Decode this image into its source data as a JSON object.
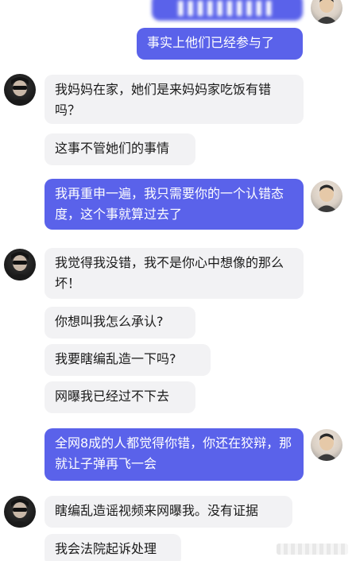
{
  "conversation": {
    "messages": [
      {
        "side": "right",
        "text": "▌▌▌▌▌▌▌▌▌▌",
        "obscured": true
      },
      {
        "side": "right",
        "text": "事实上他们已经参与了"
      },
      {
        "side": "left",
        "text": "我妈妈在家，她们是来妈妈家吃饭有错吗？"
      },
      {
        "side": "left",
        "text": "这事不管她们的事情"
      },
      {
        "side": "right",
        "text": "我再重申一遍，我只需要你的一个认错态度，这个事就算过去了"
      },
      {
        "side": "left",
        "text": "我觉得我没错，我不是你心中想像的那么坏！"
      },
      {
        "side": "left",
        "text": "你想叫我怎么承认?"
      },
      {
        "side": "left",
        "text": "我要瞎编乱造一下吗?"
      },
      {
        "side": "left",
        "text": "网曝我已经过不下去"
      },
      {
        "side": "right",
        "text": "全网8成的人都觉得你错，你还在狡辩，那就让子弹再飞一会"
      },
      {
        "side": "left",
        "text": "瞎编乱造谣视频来网曝我。没有证据"
      },
      {
        "side": "left",
        "text": "我会法院起诉处理"
      }
    ]
  },
  "colors": {
    "outgoing_bubble": "#5a62ea",
    "incoming_bubble": "#f2f2f4",
    "outgoing_text": "#ffffff",
    "incoming_text": "#1a1a1a"
  },
  "icons": {
    "left_avatar": "user-avatar-sunglasses",
    "right_avatar": "user-avatar-man"
  }
}
